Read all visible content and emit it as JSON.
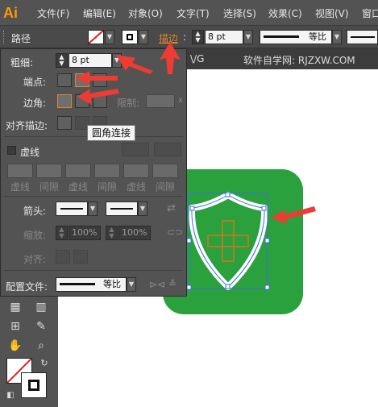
{
  "app": {
    "logo": "Ai"
  },
  "menu": {
    "items": [
      "文件(F)",
      "编辑(E)",
      "对象(O)",
      "文字(T)",
      "选择(S)",
      "效果(C)",
      "视图(V)",
      "窗口"
    ]
  },
  "control_bar": {
    "selection_label": "路径",
    "stroke_label": "描边",
    "colon": ":",
    "stroke_weight": "8 pt",
    "profile_label": "等比"
  },
  "document": {
    "tab_fragment": "\\/G",
    "watermark": "软件自学网: RJZXW.COM"
  },
  "stroke_panel": {
    "weight_label": "粗细:",
    "weight_value": "8 pt",
    "cap_label": "端点:",
    "corner_label": "边角:",
    "limit_label": "限制:",
    "limit_x": "x",
    "align_label": "对齐描边:",
    "dashed_label": "虚线",
    "dash_labels": [
      "虚线",
      "间隙",
      "虚线",
      "间隙",
      "虚线",
      "间隙"
    ],
    "arrow_label": "箭头:",
    "scale_label": "缩放:",
    "scale_start": "100%",
    "scale_end": "100%",
    "align_arrow_label": "对齐:",
    "profile_label": "配置文件:",
    "profile_value": "等比"
  },
  "tooltip": {
    "text": "圆角连接"
  },
  "colors": {
    "accent": "#e0862c",
    "icon_green": "#2aa13d",
    "cross_orange": "#d9731a",
    "arrow_red": "#ee3b33",
    "selection_blue": "#3b6fe0"
  }
}
